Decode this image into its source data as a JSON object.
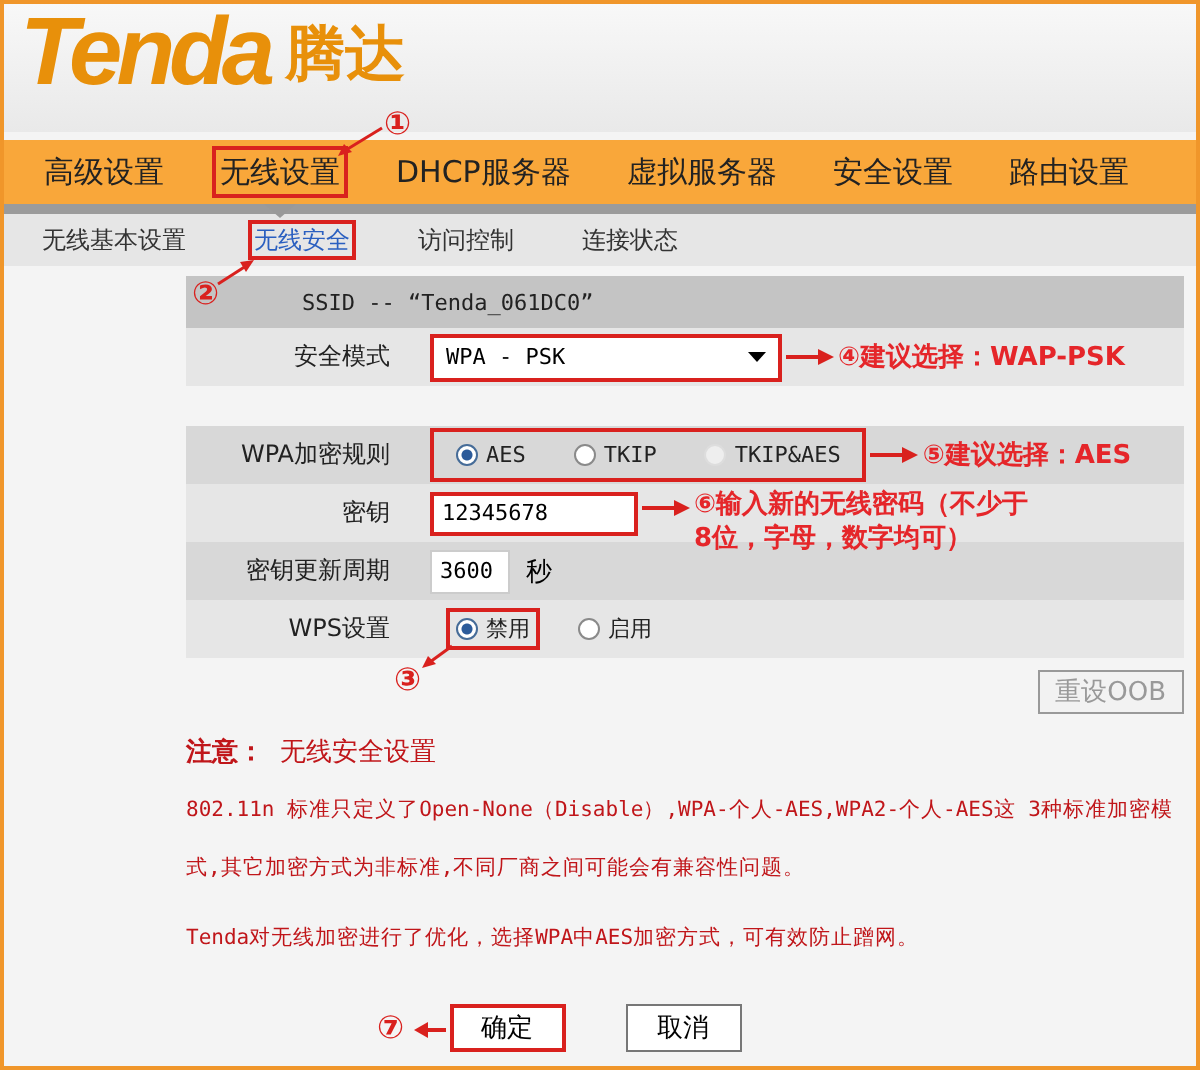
{
  "logo": {
    "brand": "Tenda",
    "brand_cn": "腾达"
  },
  "nav_tabs": [
    {
      "label": "高级设置",
      "selected": false,
      "annotated": false
    },
    {
      "label": "无线设置",
      "selected": true,
      "annotated": true,
      "marker": "①"
    },
    {
      "label": "DHCP服务器",
      "selected": false,
      "annotated": false
    },
    {
      "label": "虚拟服务器",
      "selected": false,
      "annotated": false
    },
    {
      "label": "安全设置",
      "selected": false,
      "annotated": false
    },
    {
      "label": "路由设置",
      "selected": false,
      "annotated": false
    }
  ],
  "sub_tabs": [
    {
      "label": "无线基本设置",
      "selected": false,
      "annotated": false
    },
    {
      "label": "无线安全",
      "selected": true,
      "annotated": true,
      "marker": "②"
    },
    {
      "label": "访问控制",
      "selected": false,
      "annotated": false
    },
    {
      "label": "连接状态",
      "selected": false,
      "annotated": false
    }
  ],
  "ssid": "SSID -- “Tenda_061DC0”",
  "form_rows": [
    {
      "kind": "select",
      "label": "安全模式",
      "value": "WPA - PSK",
      "annotated": true,
      "callout": "④建议选择：WAP-PSK"
    },
    {
      "kind": "radios",
      "label": "WPA加密规则",
      "annotated": true,
      "callout": "⑤建议选择：AES",
      "options": [
        {
          "label": "AES",
          "selected": true,
          "disabled": false,
          "annotated": false
        },
        {
          "label": "TKIP",
          "selected": false,
          "disabled": false,
          "annotated": false
        },
        {
          "label": "TKIP&AES",
          "selected": false,
          "disabled": true,
          "annotated": false
        }
      ]
    },
    {
      "kind": "input",
      "label": "密钥",
      "value": "12345678",
      "annotated": true,
      "callout": "⑥输入新的无线密码（不少于8位，字母，数字均可）"
    },
    {
      "kind": "input",
      "label": "密钥更新周期",
      "value": "3600",
      "unit": "秒",
      "annotated": false
    },
    {
      "kind": "radios",
      "label": "WPS设置",
      "annotated": false,
      "options": [
        {
          "label": "禁用",
          "selected": true,
          "disabled": false,
          "annotated": true,
          "marker": "③"
        },
        {
          "label": "启用",
          "selected": false,
          "disabled": false,
          "annotated": false
        }
      ]
    }
  ],
  "reset_button": {
    "label": "重设OOB",
    "disabled": true
  },
  "notes": {
    "title": "注意：",
    "subtitle": "无线安全设置",
    "paragraphs": [
      "802.11n 标准只定义了Open-None（Disable）,WPA-个人-AES,WPA2-个人-AES这 3种标准加密模式,其它加密方式为非标准,不同厂商之间可能会有兼容性问题。",
      "Tenda对无线加密进行了优化，选择WPA中AES加密方式，可有效防止蹭网。"
    ]
  },
  "buttons": [
    {
      "label": "确定",
      "annotated": true,
      "marker": "⑦"
    },
    {
      "label": "取消",
      "annotated": false
    }
  ]
}
